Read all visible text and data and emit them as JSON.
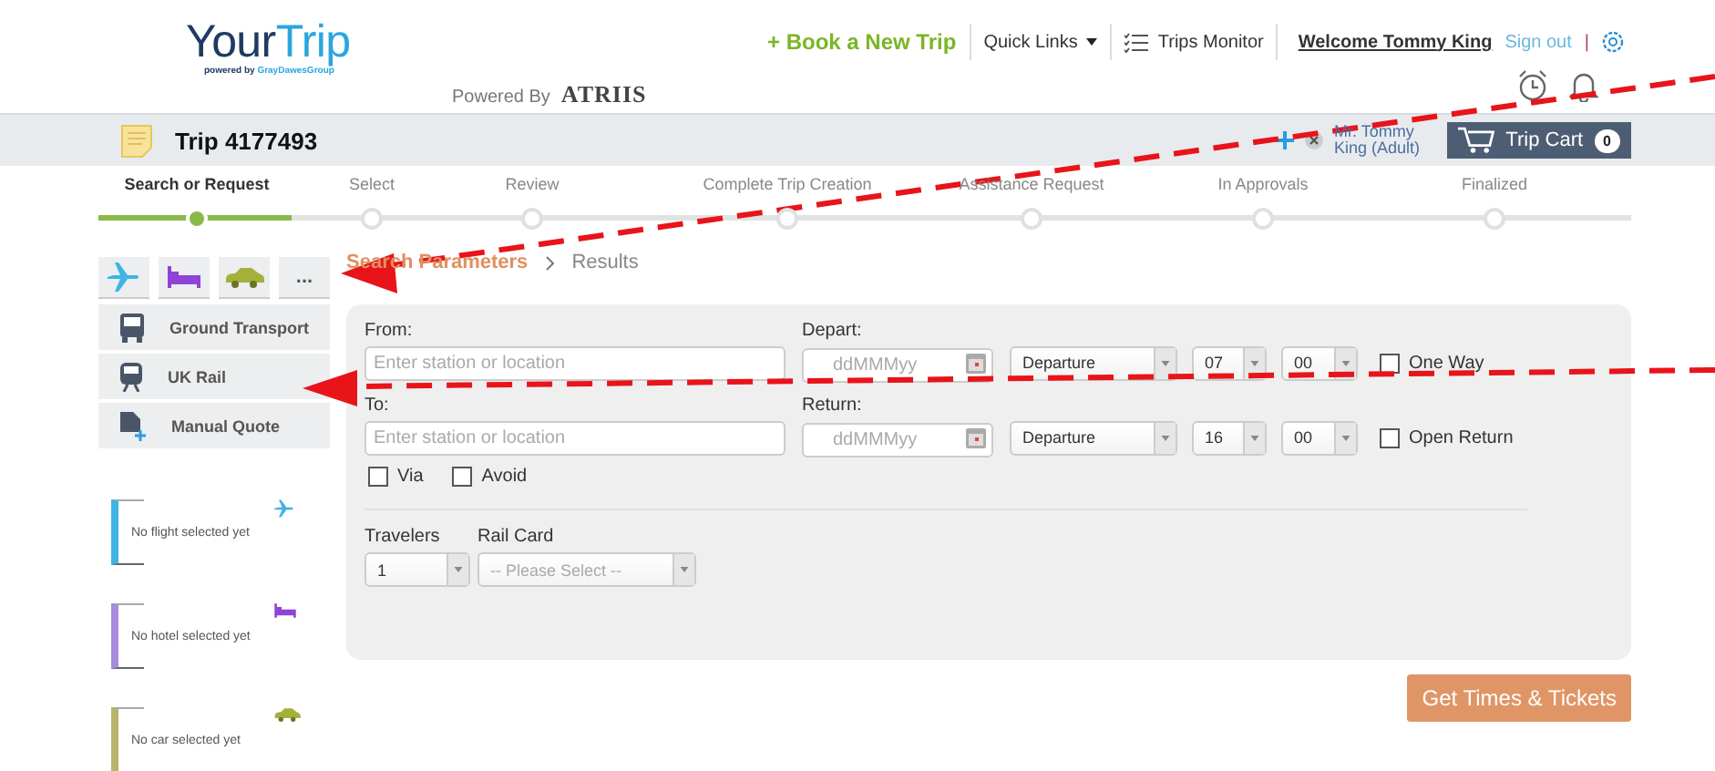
{
  "header": {
    "logo": {
      "primary": "Your",
      "accent": "Trip",
      "tagline_prefix": "powered by",
      "tagline_brand": "GrayDawesGroup"
    },
    "powered_by": {
      "label": "Powered By",
      "brand": "ATRIIS"
    },
    "nav": {
      "book_trip": "+ Book a New Trip",
      "quick_links": "Quick Links",
      "trips_monitor": "Trips Monitor",
      "welcome": "Welcome Tommy King",
      "sign_out": "Sign out",
      "separator": "|"
    }
  },
  "trip_bar": {
    "title": "Trip 4177493",
    "traveler": "Mr. Tommy King (Adult)",
    "cart": {
      "label": "Trip Cart",
      "count": "0"
    }
  },
  "steps": [
    {
      "label": "Search or Request",
      "selected": true
    },
    {
      "label": "Select",
      "selected": false
    },
    {
      "label": "Review",
      "selected": false
    },
    {
      "label": "Complete Trip Creation",
      "selected": false
    },
    {
      "label": "Assistance Request",
      "selected": false
    },
    {
      "label": "In Approvals",
      "selected": false
    },
    {
      "label": "Finalized",
      "selected": false
    }
  ],
  "product_tabs": [
    {
      "kind": "flight"
    },
    {
      "kind": "hotel"
    },
    {
      "kind": "car"
    },
    {
      "kind": "more",
      "label": "..."
    }
  ],
  "menu": [
    {
      "kind": "bus",
      "label": "Ground Transport"
    },
    {
      "kind": "train",
      "label": "UK Rail"
    },
    {
      "kind": "quote",
      "label": "Manual Quote"
    }
  ],
  "summary": [
    {
      "kind": "flight",
      "text": "No flight selected yet",
      "color": "#3fb4e5"
    },
    {
      "kind": "hotel",
      "text": "No hotel selected yet",
      "color": "#a98be0"
    },
    {
      "kind": "car",
      "text": "No car selected yet",
      "color": "#b9b46a"
    }
  ],
  "breadcrumb": [
    {
      "label": "Search Parameters",
      "selected": true
    },
    {
      "label": "Results",
      "selected": false
    }
  ],
  "form": {
    "legs": [
      {
        "place_label": "From:",
        "place_placeholder": "Enter station or location",
        "date_label": "Depart:",
        "date_placeholder": "ddMMMyy",
        "time_type": "Departure",
        "hour": "07",
        "minute": "00",
        "option": {
          "label": "One Way",
          "checked": false
        }
      },
      {
        "place_label": "To:",
        "place_placeholder": "Enter station or location",
        "date_label": "Return:",
        "date_placeholder": "ddMMMyy",
        "time_type": "Departure",
        "hour": "16",
        "minute": "00",
        "option": {
          "label": "Open Return",
          "checked": false
        }
      }
    ],
    "extras": [
      {
        "label": "Via",
        "checked": false
      },
      {
        "label": "Avoid",
        "checked": false
      }
    ],
    "travelers": {
      "label": "Travelers",
      "value": "1"
    },
    "rail_card": {
      "label": "Rail Card",
      "placeholder": "-- Please Select --"
    }
  },
  "submit": "Get Times & Tickets"
}
